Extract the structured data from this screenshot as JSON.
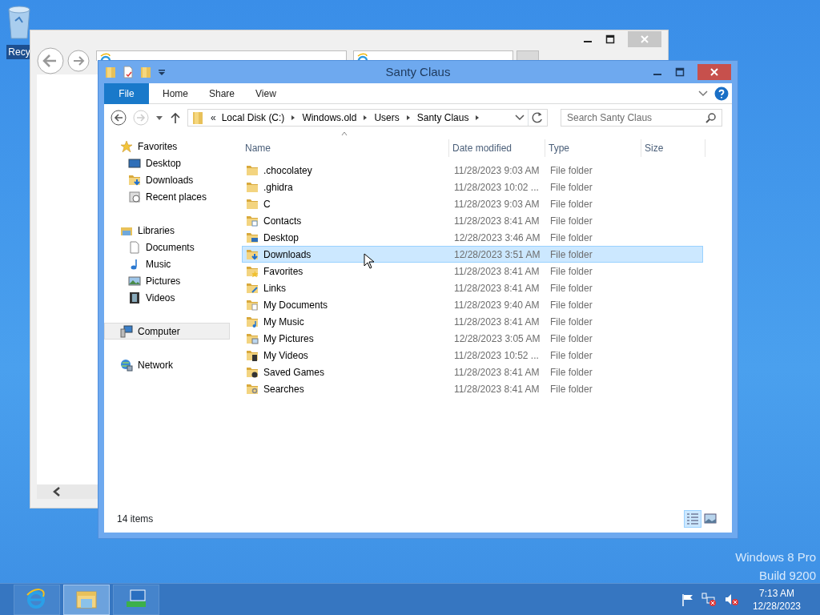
{
  "desktop": {
    "icons": [
      {
        "label": "Recy"
      }
    ]
  },
  "explorer": {
    "title": "Santy Claus",
    "ribbon": {
      "file_tab": "File",
      "tabs": [
        "Home",
        "Share",
        "View"
      ]
    },
    "address": {
      "prefix": "«",
      "crumbs": [
        "Local Disk (C:)",
        "Windows.old",
        "Users",
        "Santy Claus"
      ]
    },
    "search": {
      "placeholder": "Search Santy Claus"
    },
    "nav": [
      {
        "label": "Favorites",
        "selected": false,
        "children": [
          {
            "label": "Desktop",
            "selected": false
          },
          {
            "label": "Downloads",
            "selected": false
          },
          {
            "label": "Recent places",
            "selected": false
          }
        ]
      },
      {
        "label": "Libraries",
        "selected": false,
        "children": [
          {
            "label": "Documents",
            "selected": false
          },
          {
            "label": "Music",
            "selected": false
          },
          {
            "label": "Pictures",
            "selected": false
          },
          {
            "label": "Videos",
            "selected": false
          }
        ]
      },
      {
        "label": "Computer",
        "selected": true
      },
      {
        "label": "Network",
        "selected": false
      }
    ],
    "columns": [
      "Name",
      "Date modified",
      "Type",
      "Size"
    ],
    "rows": [
      {
        "name": ".chocolatey",
        "date": "11/28/2023 9:03 AM",
        "type": "File folder",
        "selected": false
      },
      {
        "name": ".ghidra",
        "date": "11/28/2023 10:02 ...",
        "type": "File folder",
        "selected": false
      },
      {
        "name": "C",
        "date": "11/28/2023 9:03 AM",
        "type": "File folder",
        "selected": false
      },
      {
        "name": "Contacts",
        "date": "11/28/2023 8:41 AM",
        "type": "File folder",
        "selected": false
      },
      {
        "name": "Desktop",
        "date": "12/28/2023 3:46 AM",
        "type": "File folder",
        "selected": false
      },
      {
        "name": "Downloads",
        "date": "12/28/2023 3:51 AM",
        "type": "File folder",
        "selected": true
      },
      {
        "name": "Favorites",
        "date": "11/28/2023 8:41 AM",
        "type": "File folder",
        "selected": false
      },
      {
        "name": "Links",
        "date": "11/28/2023 8:41 AM",
        "type": "File folder",
        "selected": false
      },
      {
        "name": "My Documents",
        "date": "11/28/2023 9:40 AM",
        "type": "File folder",
        "selected": false
      },
      {
        "name": "My Music",
        "date": "11/28/2023 8:41 AM",
        "type": "File folder",
        "selected": false
      },
      {
        "name": "My Pictures",
        "date": "12/28/2023 3:05 AM",
        "type": "File folder",
        "selected": false
      },
      {
        "name": "My Videos",
        "date": "11/28/2023 10:52 ...",
        "type": "File folder",
        "selected": false
      },
      {
        "name": "Saved Games",
        "date": "11/28/2023 8:41 AM",
        "type": "File folder",
        "selected": false
      },
      {
        "name": "Searches",
        "date": "11/28/2023 8:41 AM",
        "type": "File folder",
        "selected": false
      }
    ],
    "status": "14 items",
    "views": [
      {
        "selected": true
      },
      {
        "selected": false
      }
    ]
  },
  "os_version": [
    "Windows 8 Pro",
    "Build 9200"
  ],
  "taskbar": {
    "apps": [
      {
        "selected": false
      },
      {
        "selected": true
      },
      {
        "selected": false
      }
    ],
    "time": "7:13 AM",
    "date": "12/28/2023"
  }
}
